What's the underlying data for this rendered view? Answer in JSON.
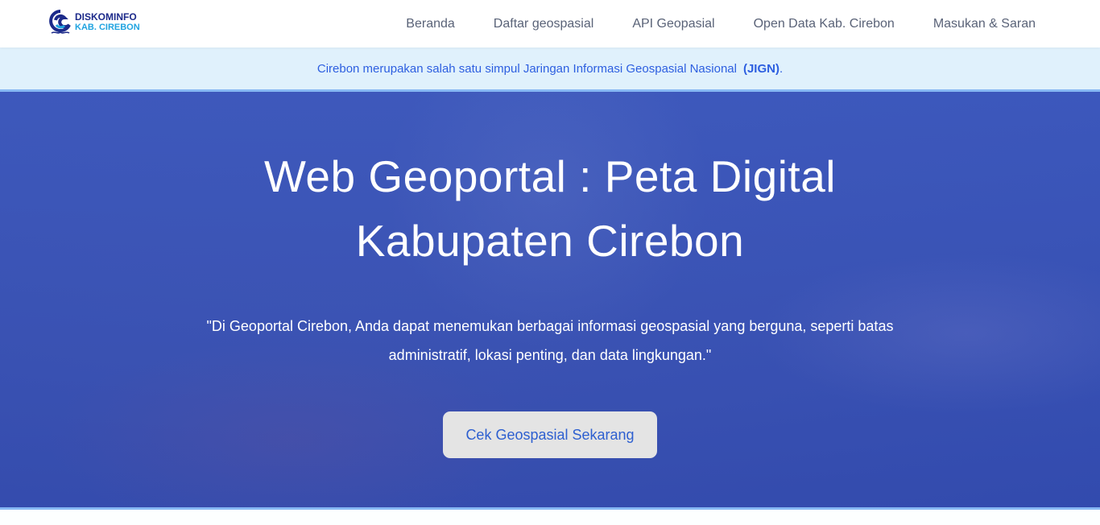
{
  "header": {
    "logo_line1": "DISKOMINFO",
    "logo_line2": "KAB. CIREBON",
    "menu": [
      "Beranda",
      "Daftar geospasial",
      "API Geopasial",
      "Open Data Kab. Cirebon",
      "Masukan & Saran"
    ]
  },
  "banner": {
    "text": "Cirebon merupakan salah satu simpul Jaringan Informasi Geospasial Nasional",
    "highlight": "(JIGN)",
    "suffix": "."
  },
  "hero": {
    "title_line1": "Web Geoportal : Peta Digital",
    "title_line2": "Kabupaten Cirebon",
    "quote": "\"Di Geoportal Cirebon, Anda dapat menemukan berbagai informasi geospasial yang berguna, seperti batas administratif, lokasi penting, dan data lingkungan.\"",
    "cta": "Cek Geospasial Sekarang"
  }
}
